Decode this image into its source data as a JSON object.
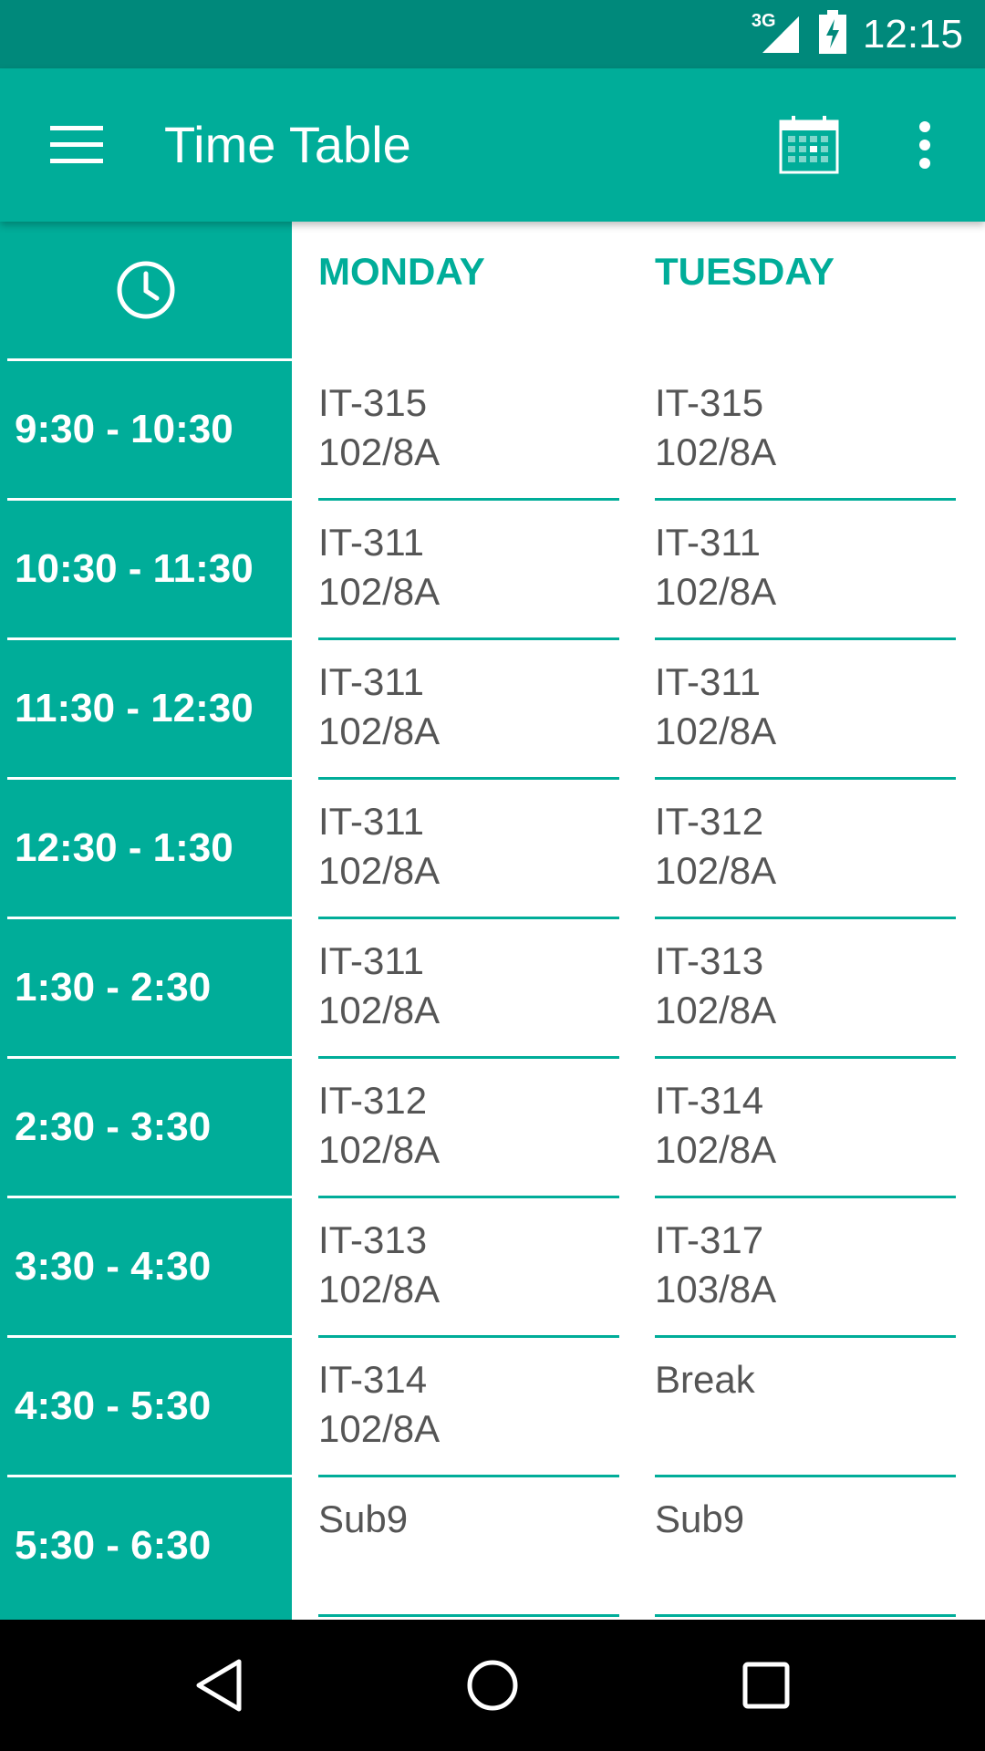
{
  "status_bar": {
    "network": "3G",
    "time": "12:15"
  },
  "app_bar": {
    "title": "Time Table"
  },
  "days": [
    "MONDAY",
    "TUESDAY"
  ],
  "time_slots": [
    "9:30 - 10:30",
    "10:30 - 11:30",
    "11:30 - 12:30",
    "12:30 - 1:30",
    "1:30 - 2:30",
    "2:30 - 3:30",
    "3:30 - 4:30",
    "4:30 - 5:30",
    "5:30 - 6:30"
  ],
  "schedule": {
    "monday": [
      {
        "code": "IT-315",
        "room": "102/8A"
      },
      {
        "code": "IT-311",
        "room": "102/8A"
      },
      {
        "code": "IT-311",
        "room": "102/8A"
      },
      {
        "code": "IT-311",
        "room": "102/8A"
      },
      {
        "code": "IT-311",
        "room": "102/8A"
      },
      {
        "code": "IT-312",
        "room": "102/8A"
      },
      {
        "code": "IT-313",
        "room": "102/8A"
      },
      {
        "code": "IT-314",
        "room": "102/8A"
      },
      {
        "code": "Sub9",
        "room": ""
      }
    ],
    "tuesday": [
      {
        "code": "IT-315",
        "room": "102/8A"
      },
      {
        "code": "IT-311",
        "room": "102/8A"
      },
      {
        "code": "IT-311",
        "room": "102/8A"
      },
      {
        "code": "IT-312",
        "room": "102/8A"
      },
      {
        "code": "IT-313",
        "room": "102/8A"
      },
      {
        "code": "IT-314",
        "room": "102/8A"
      },
      {
        "code": "IT-317",
        "room": "103/8A"
      },
      {
        "code": "Break",
        "room": ""
      },
      {
        "code": "Sub9",
        "room": ""
      }
    ]
  },
  "colors": {
    "primary": "#00ad99",
    "primary_dark": "#00897b",
    "cell_text": "#555555"
  },
  "icons": [
    "menu-icon",
    "calendar-icon",
    "more-vert-icon",
    "clock-icon",
    "back-icon",
    "home-icon",
    "recents-icon",
    "signal-icon",
    "battery-icon"
  ]
}
